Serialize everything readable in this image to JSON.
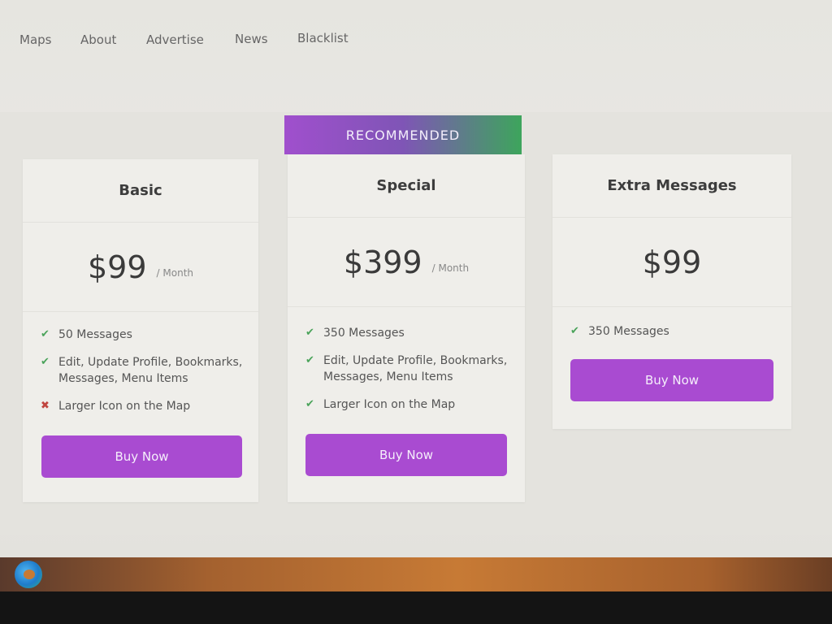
{
  "nav": {
    "items": [
      {
        "label": "Maps"
      },
      {
        "label": "About"
      },
      {
        "label": "Advertise"
      },
      {
        "label": "News"
      },
      {
        "label": "Blacklist"
      }
    ]
  },
  "ribbon": {
    "label": "RECOMMENDED"
  },
  "plans": [
    {
      "name": "Basic",
      "price": "$99",
      "period": "/ Month",
      "features": [
        {
          "text": "50 Messages",
          "included": true,
          "icon": "check-icon"
        },
        {
          "text": "Edit, Update Profile, Bookmarks, Messages, Menu Items",
          "included": true,
          "icon": "check-icon"
        },
        {
          "text": "Larger Icon on the Map",
          "included": false,
          "icon": "cross-icon"
        }
      ],
      "button": "Buy Now"
    },
    {
      "name": "Special",
      "price": "$399",
      "period": "/ Month",
      "features": [
        {
          "text": "350 Messages",
          "included": true,
          "icon": "check-icon"
        },
        {
          "text": "Edit, Update Profile, Bookmarks, Messages, Menu Items",
          "included": true,
          "icon": "check-icon"
        },
        {
          "text": "Larger Icon on the Map",
          "included": true,
          "icon": "check-icon"
        }
      ],
      "button": "Buy Now"
    },
    {
      "name": "Extra Messages",
      "price": "$99",
      "features": [
        {
          "text": "350 Messages",
          "included": true,
          "icon": "check-icon"
        }
      ],
      "button": "Buy Now"
    }
  ],
  "colors": {
    "accent": "#a94bd1",
    "check": "#4aa35a",
    "cross": "#c0453f",
    "ribbon_start": "#a04fcd",
    "ribbon_end": "#3da55c"
  },
  "taskbar": {
    "icons": [
      "edge-browser-icon"
    ]
  }
}
